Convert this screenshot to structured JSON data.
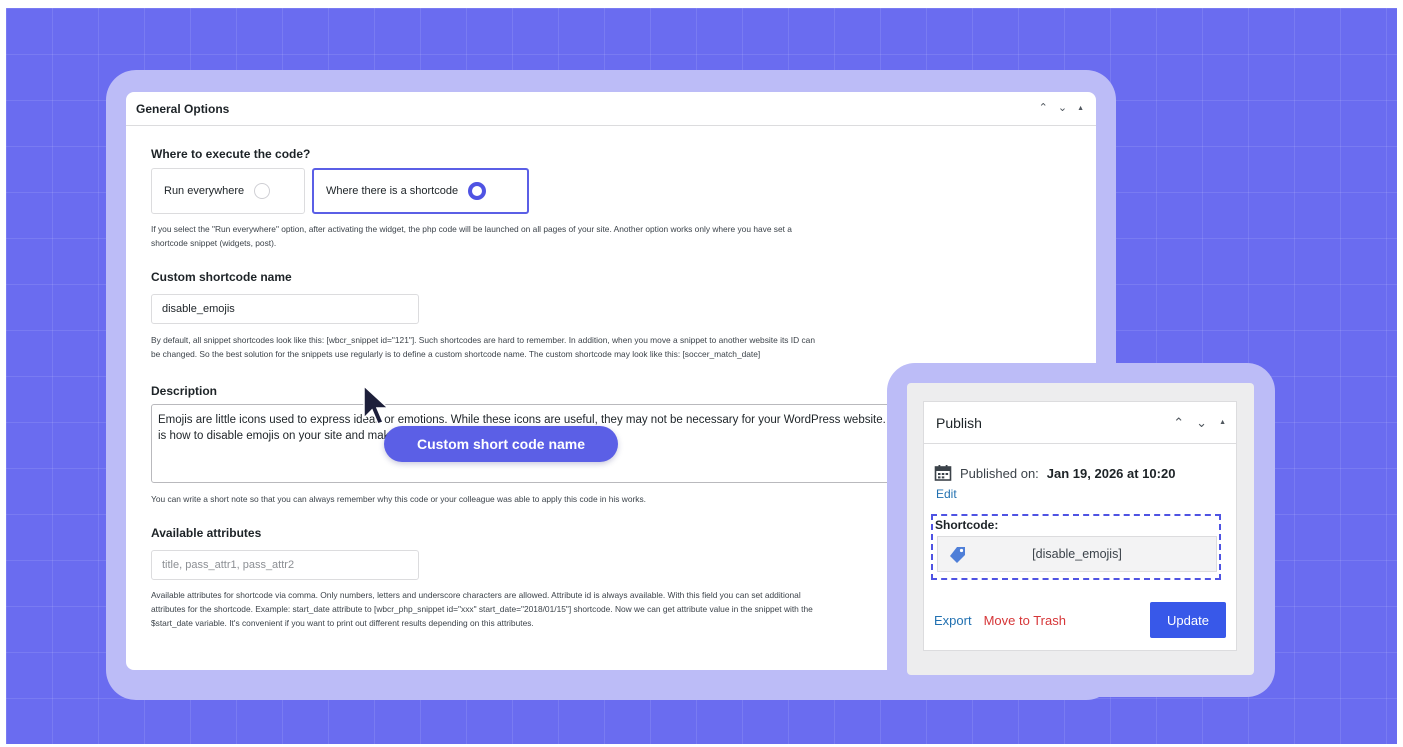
{
  "general_options": {
    "title": "General Options",
    "where_label": "Where to execute the code?",
    "options": [
      {
        "label": "Run everywhere",
        "selected": false
      },
      {
        "label": "Where there is a shortcode",
        "selected": true
      }
    ],
    "where_help_1": "If you select the \"Run everywhere\" option, after activating the widget, the php code will be launched on all pages of your site. Another option works only where you have set a",
    "where_help_2": "shortcode snippet (widgets, post).",
    "shortcode_name_label": "Custom shortcode name",
    "shortcode_name_value": "disable_emojis",
    "shortcode_help_1": "By default, all snippet shortcodes look like this: [wbcr_snippet id=\"121\"]. Such shortcodes are hard to remember. In addition, when you move a snippet to another website its ID can",
    "shortcode_help_2": "be changed. So the best solution for the snippets use regularly is to define a custom shortcode name. The custom shortcode may look like this: [soccer_match_date]",
    "description_label": "Description",
    "description_text": "Emojis are little icons used to express ideas or emotions. While these icons are useful, they may not be necessary for your WordPress website. Here is how to disable emojis on your site and make it faster.",
    "description_help": "You can write a short note so that you can always remember why this code or your colleague was able to apply this code in his works.",
    "attributes_label": "Available attributes",
    "attributes_placeholder": "title, pass_attr1, pass_attr2",
    "attributes_help_1": "Available attributes for shortcode via comma. Only numbers, letters and underscore characters are allowed. Attribute id is always available. With this field you can set additional",
    "attributes_help_2": "attributes for the shortcode. Example: start_date attribute to [wbcr_php_snippet id=\"xxx\" start_date=\"2018/01/15\"] shortcode. Now we can get attribute value in the snippet with the",
    "attributes_help_3": "$start_date variable. It's convenient if you want to print out different results depending on this attributes."
  },
  "callout": "Custom short code name",
  "publish": {
    "title": "Publish",
    "published_prefix": "Published on:",
    "published_date": "Jan 19, 2026 at 10:20",
    "edit_label": "Edit",
    "shortcode_label": "Shortcode:",
    "shortcode_value": "[disable_emojis]",
    "export_label": "Export",
    "trash_label": "Move to Trash",
    "update_label": "Update"
  },
  "icons": {
    "collapse_up": "chevron-up-icon",
    "collapse_down": "chevron-down-icon",
    "toggle": "caret-up-icon",
    "calendar": "calendar-icon",
    "tag": "tag-icon",
    "cursor": "mouse-cursor-icon"
  },
  "colors": {
    "background": "#6a6cf0",
    "frame": "#bcbcf7",
    "accent": "#4f53e3",
    "update_button": "#3858e9",
    "trash": "#d63638",
    "link": "#2271b1"
  }
}
